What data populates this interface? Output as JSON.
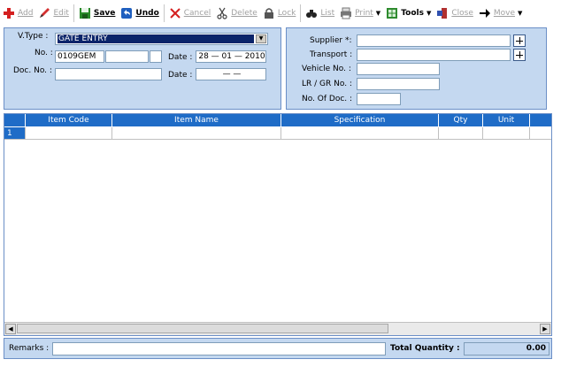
{
  "toolbar": {
    "add": "Add",
    "edit": "Edit",
    "save": "Save",
    "undo": "Undo",
    "cancel": "Cancel",
    "delete": "Delete",
    "lock": "Lock",
    "list": "List",
    "print": "Print",
    "tools": "Tools",
    "close": "Close",
    "move": "Move"
  },
  "header": {
    "vtype_label": "V.Type :",
    "vtype_value": "GATE ENTRY",
    "no_label": "No. :",
    "no_value": "0109GEM",
    "date_label": "Date :",
    "date_value": "28 — 01 — 2010",
    "docno_label": "Doc. No. :",
    "docno_value": "",
    "doc_date_label": "Date :",
    "doc_date_value": "—   —"
  },
  "supplier_panel": {
    "supplier_label": "Supplier *:",
    "transport_label": "Transport :",
    "vehicle_label": "Vehicle No. :",
    "lr_label": "LR / GR No. :",
    "nodoc_label": "No. Of Doc. :"
  },
  "grid": {
    "columns": [
      "",
      "Item Code",
      "Item Name",
      "Specification",
      "Qty",
      "Unit"
    ],
    "rows": [
      {
        "index": "1",
        "item_code": "",
        "item_name": "",
        "specification": "",
        "qty": "",
        "unit": ""
      }
    ]
  },
  "footer": {
    "remarks_label": "Remarks :",
    "remarks_value": "",
    "total_qty_label": "Total Quantity :",
    "total_qty_value": "0.00"
  },
  "colors": {
    "panel_bg": "#c4d8f0",
    "header_bg": "#1f6cc7",
    "selection": "#0a246a",
    "disabled_text": "#a0a0a0"
  }
}
